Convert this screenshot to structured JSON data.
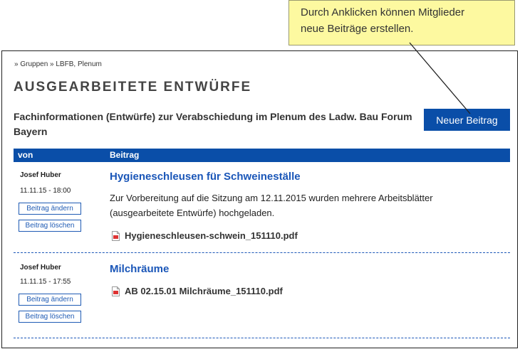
{
  "callout": {
    "line1": "Durch Anklicken können Mitglieder",
    "line2": "neue Beiträge erstellen."
  },
  "breadcrumb": "» Gruppen » LBFB, Plenum",
  "page_title": "AUSGEARBEITETE ENTWÜRFE",
  "group_description": "Fachinformationen (Entwürfe) zur Verabschiedung im Plenum des Ladw. Bau Forum Bayern",
  "new_post_button": "Neuer Beitrag",
  "table_header": {
    "col_from": "von",
    "col_post": "Beitrag"
  },
  "posts": [
    {
      "author": "Josef Huber",
      "datetime": "11.11.15 - 18:00",
      "edit_label": "Beitrag ändern",
      "delete_label": "Beitrag löschen",
      "title": "Hygieneschleusen für Schweineställe",
      "body": "Zur Vorbereitung auf die Sitzung am 12.11.2015 wurden mehrere Arbeitsblätter (ausgearbeitete Entwürfe) hochgeladen.",
      "attachment": "Hygieneschleusen-schwein_151110.pdf"
    },
    {
      "author": "Josef Huber",
      "datetime": "11.11.15 - 17:55",
      "edit_label": "Beitrag ändern",
      "delete_label": "Beitrag löschen",
      "title": "Milchräume",
      "attachment": "AB 02.15.01 Milchräume_151110.pdf"
    }
  ],
  "icons": {
    "attachment": "pdf-file-icon"
  },
  "colors": {
    "accent": "#0a4ea8",
    "link": "#1a56b8",
    "callout_bg": "#fdf9a0"
  }
}
